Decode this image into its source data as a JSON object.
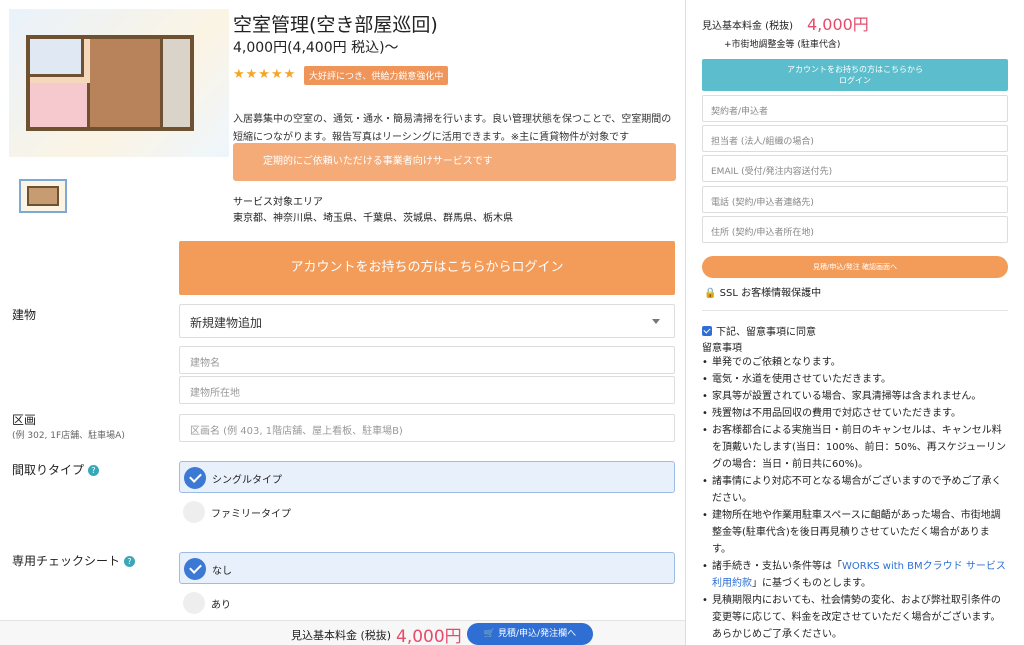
{
  "product": {
    "title": "空室管理(空き部屋巡回)",
    "price": "4,000円(4,400円 税込)〜",
    "stars": "★★★★★",
    "badge": "大好評につき、供給力鋭意強化中",
    "description": "入居募集中の空室の、通気・通水・簡易清掃を行います。良い管理状態を保つことで、空室期間の短縮につながります。報告写真はリーシングに活用できます。※主に賃貸物件が対象です",
    "banner": "定期的にご依頼いただける事業者向けサービスです",
    "area_label": "サービス対象エリア",
    "area_value": "東京都、神奈川県、埼玉県、千葉県、茨城県、群馬県、栃木県",
    "login_button": "アカウントをお持ちの方はこちらからログイン"
  },
  "form": {
    "building_label": "建物",
    "building_select": "新規建物追加",
    "building_name_placeholder": "建物名",
    "building_address_placeholder": "建物所在地",
    "section_label": "区画",
    "section_sub": "(例 302, 1F店舗、駐車場A)",
    "section_placeholder": "区画名 (例 403, 1階店舗、屋上看板、駐車場B)",
    "layout_label": "間取りタイプ",
    "layout_options": [
      "シングルタイプ",
      "ファミリータイプ"
    ],
    "checksheet_label": "専用チェックシート",
    "checksheet_options": [
      "なし",
      "あり"
    ],
    "help_icon": "?"
  },
  "bottom_bar": {
    "label": "見込基本料金 (税抜)",
    "price": "4,000円",
    "button": "見積/申込/発注欄へ"
  },
  "sidebar": {
    "price_label": "見込基本料金 (税抜)",
    "price": "4,000円",
    "sub": "+市街地調整金等 (駐車代含)",
    "login_line1": "アカウントをお持ちの方はこちらから",
    "login_line2": "ログイン",
    "inputs": [
      "契約者/申込者",
      "担当者 (法人/組織の場合)",
      "EMAIL (受付/発注内容送付先)",
      "電話 (契約/申込者連絡先)",
      "住所 (契約/申込者所在地)"
    ],
    "confirm_button": "見積/申込/発注 確認画面へ",
    "ssl": "🔒 SSL お客様情報保護中",
    "agree": "下記、留意事項に同意",
    "notes_title": "留意事項",
    "notes": [
      "単発でのご依頼となります。",
      "電気・水道を使用させていただきます。",
      "家具等が設置されている場合、家具清掃等は含まれません。",
      "残置物は不用品回収の費用で対応させていただきます。",
      "お客様都合による実施当日・前日のキャンセルは、キャンセル料を頂戴いたします(当日：100%、前日：50%、再スケジューリングの場合：当日・前日共に60%)。",
      "諸事情により対応不可となる場合がございますので予めご了承ください。",
      "建物所在地や作業用駐車スペースに齟齬があった場合、市街地調整金等(駐車代含)を後日再見積りさせていただく場合があります。"
    ],
    "note_terms_prefix": "諸手続き・支払い条件等は「",
    "note_terms_link": "WORKS with BMクラウド サービス利用約款",
    "note_terms_suffix": "」に基づくものとします。",
    "note_last": "見積期限内においても、社会情勢の変化、および弊社取引条件の変更等に応じて、料金を改定させていただく場合がございます。あらかじめご了承ください。"
  }
}
